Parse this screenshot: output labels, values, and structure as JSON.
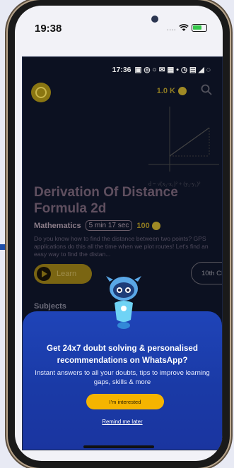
{
  "ios_status": {
    "time": "19:38",
    "signal": "....",
    "wifi_icon": "wifi-icon",
    "battery_icon": "battery-charging-icon"
  },
  "app_status": {
    "time": "17:36",
    "icons": "▣ ◎ ○ ✉ ▦ • ◷ ▤ ◢ ◌"
  },
  "header": {
    "coins": "1.0 K"
  },
  "video": {
    "title": "Derivation Of Distance Formula 2d",
    "subject": "Mathematics",
    "duration": "5 min 17 sec",
    "points": "100",
    "description": "Do you know how to find the distance between two points? GPS applications do this all the time when we plot routes! Let's find an easy way to find the distan...",
    "learn_label": "Learn",
    "tag": "10th CBSE",
    "formula": "d = √(x₂-x₁)² + (y₂-y₁)²"
  },
  "section": {
    "subjects": "Subjects"
  },
  "sheet": {
    "headline": "Get 24x7 doubt solving & personalised recommendations on WhatsApp?",
    "subtext": "Instant answers to all your doubts, tips to improve learning gaps, skills & more",
    "cta": "I'm interested",
    "later": "Remind me later"
  },
  "colors": {
    "sheet_blue": "#1f44b8",
    "cta_yellow": "#f5b400",
    "app_bg": "#0c1121",
    "gold": "#8d7a22"
  }
}
